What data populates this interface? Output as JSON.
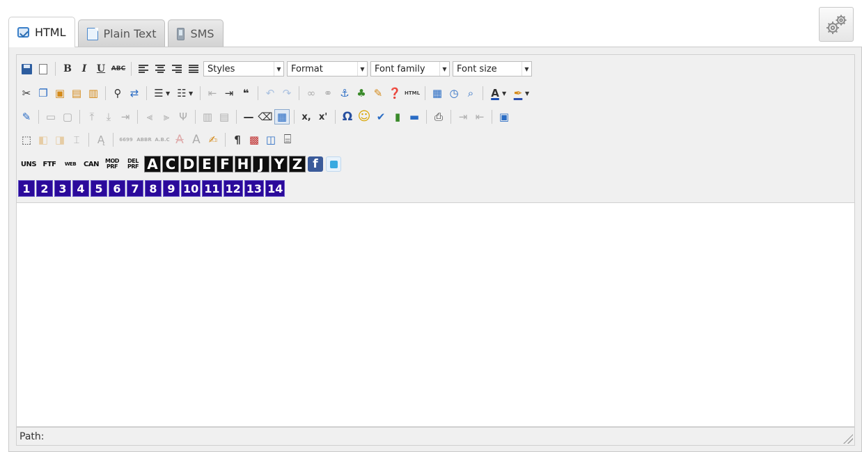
{
  "tabs": [
    {
      "label": "HTML",
      "icon": "html-icon",
      "active": true
    },
    {
      "label": "Plain Text",
      "icon": "document-icon",
      "active": false
    },
    {
      "label": "SMS",
      "icon": "phone-icon",
      "active": false
    }
  ],
  "settings": {
    "icon": "gears-icon"
  },
  "toolbar": {
    "selects": {
      "styles": "Styles",
      "format": "Format",
      "font_family": "Font family",
      "font_size": "Font size"
    },
    "row3_text": {
      "subscript": "x,",
      "superscript": "x'",
      "omega": "Ω",
      "pilcrow": "¶"
    },
    "row5": {
      "uns": "UNS",
      "ftf": "FTF",
      "web": "WEB",
      "can": "CAN",
      "mod_pref_top": "MOD",
      "mod_pref_bottom": "PRF",
      "del_pref_top": "DEL",
      "del_pref_bottom": "PRF",
      "letters": [
        "A",
        "C",
        "D",
        "E",
        "F",
        "H",
        "J",
        "Y",
        "Z"
      ],
      "facebook": "f"
    },
    "numbers": [
      "1",
      "2",
      "3",
      "4",
      "5",
      "6",
      "7",
      "8",
      "9",
      "10",
      "11",
      "12",
      "13",
      "14"
    ]
  },
  "statusbar": {
    "path_label": "Path:"
  },
  "colors": {
    "number_button": "#2b0a9b",
    "letter_button": "#0f0f0f",
    "facebook": "#3b5b9a"
  }
}
